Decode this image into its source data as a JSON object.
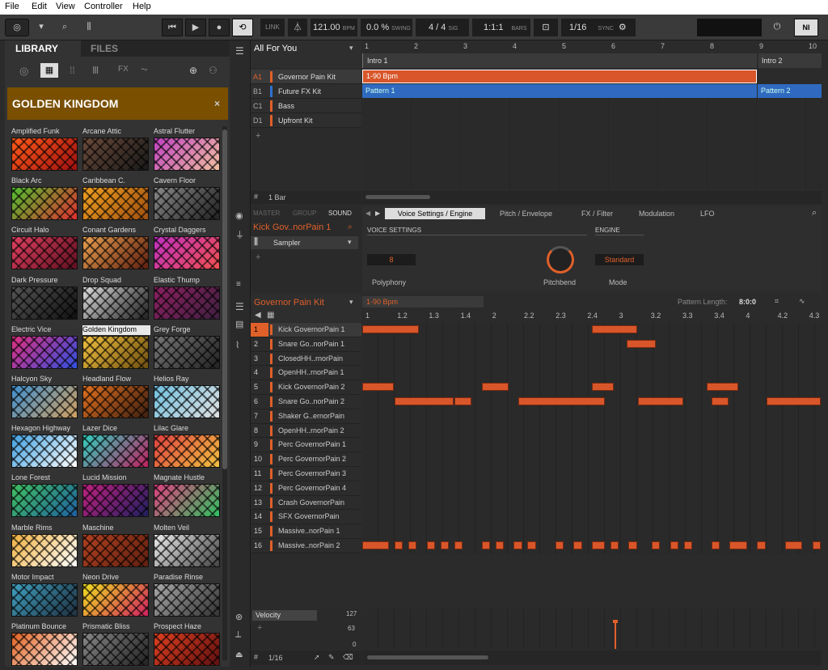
{
  "menu": [
    "File",
    "Edit",
    "View",
    "Controller",
    "Help"
  ],
  "transport": {
    "tempo": "121.00",
    "tempo_unit": "BPM",
    "swing": "0.0 %",
    "swing_label": "SWING",
    "sig": "4 / 4",
    "sig_label": "SIG",
    "bars": "1:1:1",
    "bars_label": "BARS",
    "grid": "1/16",
    "sync": "SYNC",
    "link": "LINK"
  },
  "library": {
    "tab_library": "LIBRARY",
    "tab_files": "FILES",
    "banner": "GOLDEN KINGDOM",
    "close": "×",
    "tiles": [
      {
        "label": "Amplified Funk",
        "c1": "#ff5a1a",
        "c2": "#a01010"
      },
      {
        "label": "Arcane Attic",
        "c1": "#6a4a3a",
        "c2": "#1a1a1a"
      },
      {
        "label": "Astral Flutter",
        "c1": "#c040c0",
        "c2": "#f0c0a0"
      },
      {
        "label": "Black Arc",
        "c1": "#50c030",
        "c2": "#e03030"
      },
      {
        "label": "Caribbean C.",
        "c1": "#f0a020",
        "c2": "#a05010"
      },
      {
        "label": "Cavern Floor",
        "c1": "#888",
        "c2": "#222"
      },
      {
        "label": "Circuit Halo",
        "c1": "#e04060",
        "c2": "#601020"
      },
      {
        "label": "Conant Gardens",
        "c1": "#e8a050",
        "c2": "#602010"
      },
      {
        "label": "Crystal Daggers",
        "c1": "#c030c0",
        "c2": "#f05050"
      },
      {
        "label": "Dark Pressure",
        "c1": "#555",
        "c2": "#111"
      },
      {
        "label": "Drop Squad",
        "c1": "#ddd",
        "c2": "#222"
      },
      {
        "label": "Elastic Thump",
        "c1": "#8a2060",
        "c2": "#402040"
      },
      {
        "label": "Electric Vice",
        "c1": "#e03080",
        "c2": "#3050e0"
      },
      {
        "label": "Golden Kingdom",
        "c1": "#f0c040",
        "c2": "#705010"
      },
      {
        "label": "Grey Forge",
        "c1": "#777",
        "c2": "#222"
      },
      {
        "label": "Halcyon Sky",
        "c1": "#4090d0",
        "c2": "#d0a060"
      },
      {
        "label": "Headland Flow",
        "c1": "#e07020",
        "c2": "#402010"
      },
      {
        "label": "Helios Ray",
        "c1": "#70c0e0",
        "c2": "#e0e0e0"
      },
      {
        "label": "Hexagon Highway",
        "c1": "#40a0e0",
        "c2": "#fff"
      },
      {
        "label": "Lazer Dice",
        "c1": "#30d0c0",
        "c2": "#c02060"
      },
      {
        "label": "Lilac Glare",
        "c1": "#e04040",
        "c2": "#f0c040"
      },
      {
        "label": "Lone Forest",
        "c1": "#40c060",
        "c2": "#2060a0"
      },
      {
        "label": "Lucid Mission",
        "c1": "#c02080",
        "c2": "#202060"
      },
      {
        "label": "Magnate Hustle",
        "c1": "#e04080",
        "c2": "#30c060"
      },
      {
        "label": "Marble Rims",
        "c1": "#f0b040",
        "c2": "#fff"
      },
      {
        "label": "Maschine",
        "c1": "#b04020",
        "c2": "#602010"
      },
      {
        "label": "Molten Veil",
        "c1": "#eee",
        "c2": "#444"
      },
      {
        "label": "Motor Impact",
        "c1": "#40a0c0",
        "c2": "#203040"
      },
      {
        "label": "Neon Drive",
        "c1": "#f0e020",
        "c2": "#d02060"
      },
      {
        "label": "Paradise Rinse",
        "c1": "#aaa",
        "c2": "#333"
      },
      {
        "label": "Platinum Bounce",
        "c1": "#e06020",
        "c2": "#fff"
      },
      {
        "label": "Prismatic Bliss",
        "c1": "#888",
        "c2": "#222"
      },
      {
        "label": "Prospect Haze",
        "c1": "#e04020",
        "c2": "#601010"
      }
    ]
  },
  "arranger": {
    "title": "All For You",
    "sections": [
      "Intro 1",
      "Intro 2"
    ],
    "bar_numbers": [
      "1",
      "2",
      "3",
      "4",
      "5",
      "6",
      "7",
      "8",
      "9",
      "10"
    ],
    "groups": [
      {
        "code": "A1",
        "name": "Governor Pain Kit",
        "color": "#e0602a"
      },
      {
        "code": "B1",
        "name": "Future FX Kit",
        "color": "#3070d0"
      },
      {
        "code": "C1",
        "name": "Bass",
        "color": "#e0602a"
      },
      {
        "code": "D1",
        "name": "Upfront Kit",
        "color": "#e0602a"
      }
    ],
    "scene_clip": "1-90 Bpm",
    "pattern1": "Pattern 1",
    "pattern2": "Pattern 2",
    "length": "1 Bar",
    "add": "+"
  },
  "sound": {
    "tabs": [
      "MASTER",
      "GROUP",
      "SOUND"
    ],
    "name": "Kick Gov..norPain 1",
    "plugin": "Sampler",
    "add": "+",
    "pages": [
      "Voice Settings / Engine",
      "Pitch / Envelope",
      "FX / Filter",
      "Modulation",
      "LFO"
    ],
    "section1": "VOICE SETTINGS",
    "section2": "ENGINE",
    "polyphony_value": "8",
    "polyphony_label": "Polyphony",
    "pitchbend_label": "Pitchbend",
    "mode_value": "Standard",
    "mode_label": "Mode"
  },
  "pattern": {
    "kit": "Governor Pain Kit",
    "pattern_name": "1-90 Bpm",
    "length_label": "Pattern Length:",
    "length": "8:0:0",
    "ruler": [
      "1",
      "1.2",
      "1.3",
      "1.4",
      "2",
      "2.2",
      "2.3",
      "2.4",
      "3",
      "3.2",
      "3.3",
      "3.4",
      "4",
      "4.2",
      "4.3"
    ],
    "pads": [
      "Kick GovernorPain 1",
      "Snare Go..norPain 1",
      "ClosedHH..rnorPain",
      "OpenHH..rnorPain 1",
      "Kick GovernorPain 2",
      "Snare Go..norPain 2",
      "Shaker G..ernorPain",
      "OpenHH..rnorPain 2",
      "Perc GovernorPain 1",
      "Perc GovernorPain 2",
      "Perc GovernorPain 3",
      "Perc GovernorPain 4",
      "Crash GovernorPain",
      "SFX GovernorPain",
      "Massive..norPain 1",
      "Massive..norPain 2"
    ],
    "pad_numbers": [
      "1",
      "2",
      "3",
      "4",
      "5",
      "6",
      "7",
      "8",
      "9",
      "10",
      "11",
      "12",
      "13",
      "14",
      "15",
      "16"
    ]
  },
  "velocity": {
    "label": "Velocity",
    "max": "127",
    "mid": "63",
    "min": "0",
    "add": "+"
  },
  "footer": {
    "grid": "1/16"
  }
}
